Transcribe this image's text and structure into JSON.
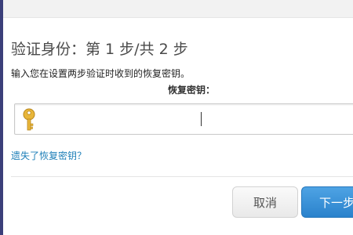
{
  "dialog": {
    "title": "验证身份：第 1 步/共 2 步",
    "instruction": "输入您在设置两步验证时收到的恢复密钥。",
    "field_label": "恢复密钥：",
    "recovery_key": {
      "value": "",
      "icon": "key-icon"
    },
    "lost_key_link": "遗失了恢复密钥？",
    "buttons": {
      "cancel": "取消",
      "next": "下一步"
    }
  },
  "colors": {
    "link": "#1e7fb8",
    "primary_button": "#2a82cc",
    "frame": "#3b3f7a"
  }
}
